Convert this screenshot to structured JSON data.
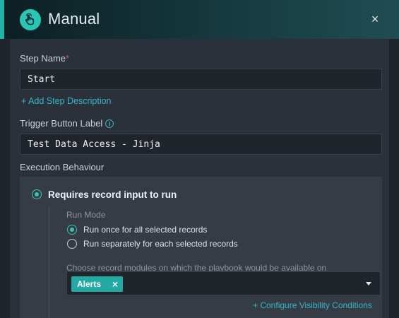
{
  "header": {
    "title": "Manual",
    "icon": "hand-pointer-icon",
    "close_glyph": "×"
  },
  "step_name": {
    "label": "Step Name",
    "required_mark": "*",
    "value": "Start"
  },
  "add_description_link": "+ Add Step Description",
  "trigger_button": {
    "label": "Trigger Button Label",
    "info_glyph": "i",
    "value": "Test Data Access - Jinja"
  },
  "execution": {
    "label": "Execution Behaviour",
    "requires_input_label": "Requires record input to run",
    "requires_input_selected": true,
    "run_mode": {
      "label": "Run Mode",
      "options": [
        {
          "label": "Run once for all selected records",
          "selected": true
        },
        {
          "label": "Run separately for each selected records",
          "selected": false
        }
      ]
    },
    "modules": {
      "label": "Choose record modules on which the playbook would be available on",
      "tags": [
        {
          "label": "Alerts",
          "remove_glyph": "×"
        }
      ]
    },
    "configure_link": "+ Configure Visibility Conditions"
  },
  "colors": {
    "accent": "#27c6b5",
    "link": "#35b6c6",
    "tag": "#22a9a4",
    "required": "#e0524f"
  }
}
